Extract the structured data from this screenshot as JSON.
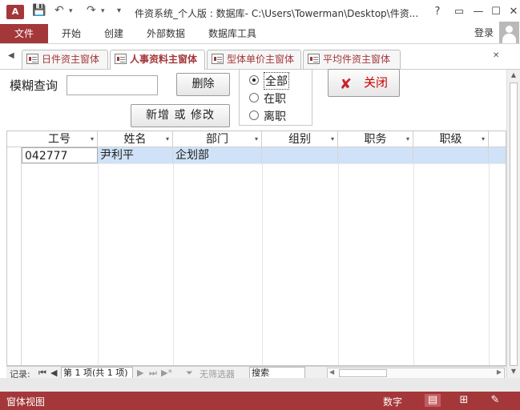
{
  "window": {
    "app_icon": "A",
    "title": "件资系统_个人版 : 数据库- C:\\Users\\Towerman\\Desktop\\件资...",
    "help": "?",
    "minimize": "—",
    "restore": "☐",
    "close": "✕",
    "undo": "↶",
    "redo": "↷"
  },
  "ribbon": {
    "tabs": [
      "文件",
      "开始",
      "创建",
      "外部数据",
      "数据库工具"
    ],
    "login": "登录"
  },
  "doc_tabs": {
    "items": [
      "日件资主窗体",
      "人事资料主窗体",
      "型体单价主窗体",
      "平均件资主窗体"
    ],
    "active_index": 1
  },
  "form": {
    "search_label": "模糊查询",
    "search_value": "",
    "delete_label": "删除",
    "add_modify_label": "新增 或 修改",
    "close_label": "关闭",
    "filter_options": [
      "全部",
      "在职",
      "离职"
    ],
    "filter_selected": "全部"
  },
  "grid": {
    "columns": [
      "工号",
      "姓名",
      "部门",
      "组别",
      "职务",
      "职级"
    ],
    "rows": [
      [
        "042777",
        "尹利平",
        "企划部",
        "",
        "",
        ""
      ]
    ]
  },
  "record_nav": {
    "label": "记录:",
    "position": "第 1 项(共 1 项)",
    "filter": "无筛选器",
    "search": "搜索"
  },
  "status": {
    "view": "窗体视图",
    "num": "数字"
  },
  "colors": {
    "accent": "#a4373a",
    "selected_row": "#cfe2f7"
  }
}
